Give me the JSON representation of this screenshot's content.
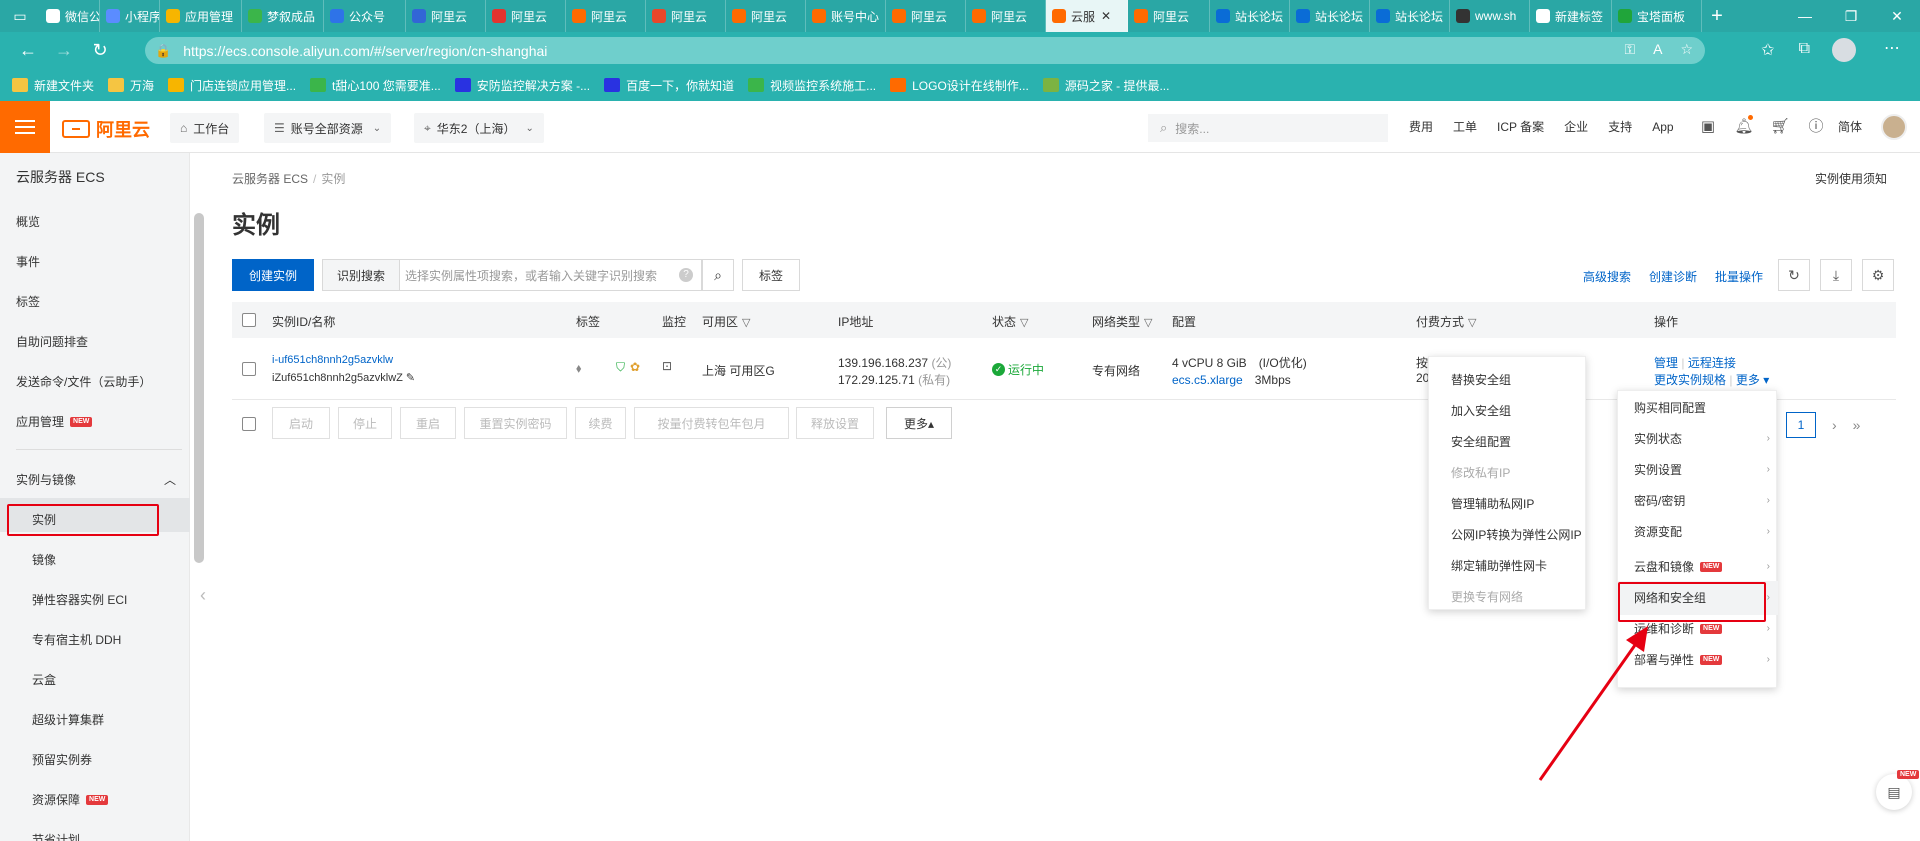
{
  "browser": {
    "tabs": [
      {
        "label": "微信公众",
        "color": "#ffffff"
      },
      {
        "label": "小程序",
        "color": "#5b8cff"
      },
      {
        "label": "应用管理",
        "color": "#f7b500"
      },
      {
        "label": "梦叙成品",
        "color": "#3bb54a"
      },
      {
        "label": "公众号",
        "color": "#2e73e8"
      },
      {
        "label": "阿里云",
        "color": "#3266d6"
      },
      {
        "label": "阿里云",
        "color": "#e3342f"
      },
      {
        "label": "阿里云",
        "color": "#ff6a00"
      },
      {
        "label": "阿里云",
        "color": "#e8472a"
      },
      {
        "label": "阿里云",
        "color": "#ff6a00"
      },
      {
        "label": "账号中心",
        "color": "#ff6a00"
      },
      {
        "label": "阿里云",
        "color": "#ff6a00"
      },
      {
        "label": "阿里云",
        "color": "#ff6a00"
      },
      {
        "label": "云服",
        "color": "#ff6a00",
        "active": true
      },
      {
        "label": "阿里云",
        "color": "#ff6a00"
      },
      {
        "label": "站长论坛",
        "color": "#0a6cd6"
      },
      {
        "label": "站长论坛",
        "color": "#0a6cd6"
      },
      {
        "label": "站长论坛",
        "color": "#0a6cd6"
      },
      {
        "label": "www.sh",
        "color": "#333333"
      },
      {
        "label": "新建标签",
        "color": "#ffffff"
      },
      {
        "label": "宝塔面板",
        "color": "#20a53a"
      }
    ],
    "url": "https://ecs.console.aliyun.com/#/server/region/cn-shanghai",
    "bookmarks": [
      {
        "label": "新建文件夹",
        "icon": "folder-icon"
      },
      {
        "label": "万海",
        "icon": "folder-icon"
      },
      {
        "label": "门店连锁应用管理...",
        "icon": "app-icon"
      },
      {
        "label": "t甜心100 您需要准...",
        "icon": "site-icon"
      },
      {
        "label": "安防监控解决方案 -...",
        "icon": "baidu-icon"
      },
      {
        "label": "百度一下，你就知道",
        "icon": "baidu-icon"
      },
      {
        "label": "视频监控系统施工...",
        "icon": "site-icon"
      },
      {
        "label": "LOGO设计在线制作...",
        "icon": "aliyun-icon"
      },
      {
        "label": "源码之家 - 提供最...",
        "icon": "m-icon"
      }
    ]
  },
  "topnav": {
    "logo": "阿里云",
    "workbench": "工作台",
    "account_scope": "账号全部资源",
    "region": "华东2（上海）",
    "search_placeholder": "搜索...",
    "links": [
      "费用",
      "工单",
      "ICP 备案",
      "企业",
      "支持",
      "App"
    ],
    "lang": "简体"
  },
  "sidebar": {
    "title": "云服务器 ECS",
    "top_items": [
      {
        "label": "概览"
      },
      {
        "label": "事件"
      },
      {
        "label": "标签"
      },
      {
        "label": "自助问题排查"
      },
      {
        "label": "发送命令/文件（云助手）"
      },
      {
        "label": "应用管理",
        "badge": "NEW"
      }
    ],
    "group": "实例与镜像",
    "group_items": [
      {
        "label": "实例"
      },
      {
        "label": "镜像"
      },
      {
        "label": "弹性容器实例 ECI"
      },
      {
        "label": "专有宿主机 DDH"
      },
      {
        "label": "云盒"
      },
      {
        "label": "超级计算集群"
      },
      {
        "label": "预留实例券"
      },
      {
        "label": "资源保障",
        "badge": "NEW"
      },
      {
        "label": "节省计划"
      }
    ]
  },
  "main": {
    "breadcrumb": [
      "云服务器 ECS",
      "实例"
    ],
    "help_link": "实例使用须知",
    "title": "实例",
    "create_button": "创建实例",
    "search_mode": "识别搜索",
    "search_placeholder": "选择实例属性项搜索，或者输入关键字识别搜索",
    "tag_button": "标签",
    "right_links": [
      "高级搜索",
      "创建诊断",
      "批量操作"
    ],
    "columns": [
      "实例ID/名称",
      "标签",
      "监控",
      "可用区",
      "IP地址",
      "状态",
      "网络类型",
      "配置",
      "付费方式",
      "操作"
    ],
    "rows": [
      {
        "id": "i-uf651ch8nnh2g5azvklw",
        "name": "iZuf651ch8nnh2g5azvklwZ",
        "zone": "上海 可用区G",
        "public_ip": "139.196.168.237",
        "public_tag": "(公)",
        "private_ip": "172.29.125.71",
        "private_tag": "(私有)",
        "status": "运行中",
        "network": "专有网络",
        "config_line1": "4 vCPU 8 GiB　(I/O优化)",
        "config_type": "ecs.c5.xlarge",
        "config_bw": "3Mbps",
        "billing_line1": "按",
        "billing_line2": "20",
        "actions": [
          "管理",
          "远程连接",
          "更改实例规格",
          "更多"
        ]
      }
    ],
    "bulk_buttons": [
      "启动",
      "停止",
      "重启",
      "重置实例密码",
      "续费",
      "按量付费转包年包月",
      "释放设置"
    ],
    "more_button": "更多▴",
    "page": "1"
  },
  "menu_more": {
    "items": [
      {
        "label": "购买相同配置"
      },
      {
        "label": "实例状态"
      },
      {
        "label": "实例设置"
      },
      {
        "label": "密码/密钥"
      },
      {
        "label": "资源变配"
      },
      {
        "label": "云盘和镜像",
        "badge": "NEW"
      },
      {
        "label": "网络和安全组"
      },
      {
        "label": "运维和诊断",
        "badge": "NEW"
      },
      {
        "label": "部署与弹性",
        "badge": "NEW"
      }
    ]
  },
  "menu_network": {
    "items": [
      {
        "label": "替换安全组"
      },
      {
        "label": "加入安全组"
      },
      {
        "label": "安全组配置"
      },
      {
        "label": "修改私有IP",
        "disabled": true
      },
      {
        "label": "管理辅助私网IP"
      },
      {
        "label": "公网IP转换为弹性公网IP"
      },
      {
        "label": "绑定辅助弹性网卡"
      },
      {
        "label": "更换专有网络",
        "disabled": true
      }
    ]
  },
  "float_badge": "NEW",
  "colors": {
    "brand": "#ff6a00",
    "primary": "#0064c8",
    "annotation": "#e60012",
    "success": "#1ba839"
  }
}
